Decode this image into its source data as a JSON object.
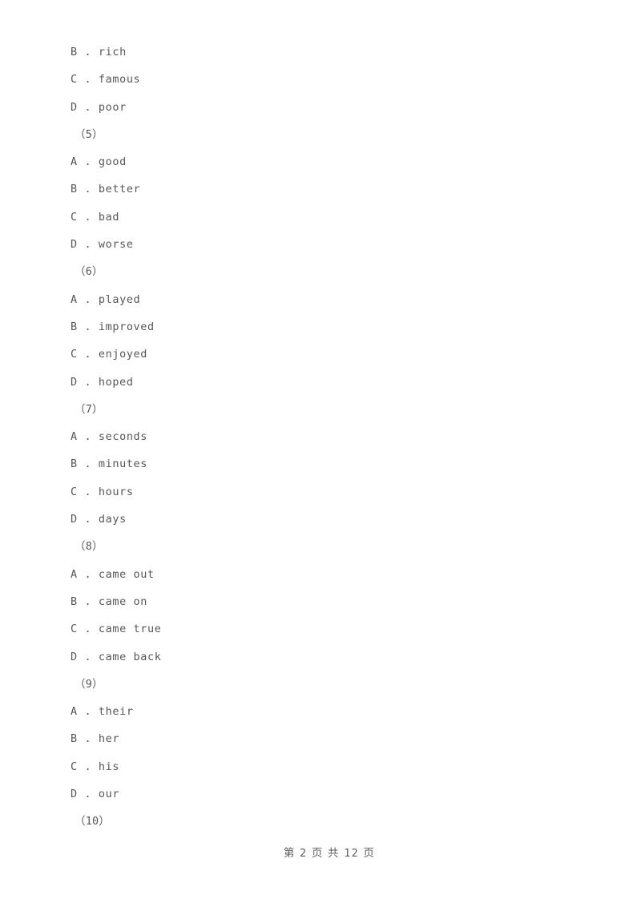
{
  "page": {
    "background_color": "#ffffff",
    "text_color": "#57575a"
  },
  "content": {
    "blocks": [
      {
        "type": "options",
        "items": [
          {
            "letter": "B",
            "sep": " . ",
            "text": "rich"
          },
          {
            "letter": "C",
            "sep": " . ",
            "text": "famous"
          },
          {
            "letter": "D",
            "sep": " . ",
            "text": "poor"
          }
        ]
      },
      {
        "type": "question_number",
        "label": "（5）"
      },
      {
        "type": "options",
        "items": [
          {
            "letter": "A",
            "sep": " . ",
            "text": "good"
          },
          {
            "letter": "B",
            "sep": " . ",
            "text": "better"
          },
          {
            "letter": "C",
            "sep": " . ",
            "text": "bad"
          },
          {
            "letter": "D",
            "sep": " . ",
            "text": "worse"
          }
        ]
      },
      {
        "type": "question_number",
        "label": "（6）"
      },
      {
        "type": "options",
        "items": [
          {
            "letter": "A",
            "sep": " . ",
            "text": "played"
          },
          {
            "letter": "B",
            "sep": " . ",
            "text": "improved"
          },
          {
            "letter": "C",
            "sep": " . ",
            "text": "enjoyed"
          },
          {
            "letter": "D",
            "sep": " . ",
            "text": "hoped"
          }
        ]
      },
      {
        "type": "question_number",
        "label": "（7）"
      },
      {
        "type": "options",
        "items": [
          {
            "letter": "A",
            "sep": " . ",
            "text": "seconds"
          },
          {
            "letter": "B",
            "sep": " . ",
            "text": "minutes"
          },
          {
            "letter": "C",
            "sep": " . ",
            "text": "hours"
          },
          {
            "letter": "D",
            "sep": " . ",
            "text": "days"
          }
        ]
      },
      {
        "type": "question_number",
        "label": "（8）"
      },
      {
        "type": "options",
        "items": [
          {
            "letter": "A",
            "sep": " . ",
            "text": "came out"
          },
          {
            "letter": "B",
            "sep": " . ",
            "text": "came on"
          },
          {
            "letter": "C",
            "sep": " . ",
            "text": "came true"
          },
          {
            "letter": "D",
            "sep": " . ",
            "text": "came back"
          }
        ]
      },
      {
        "type": "question_number",
        "label": "（9）"
      },
      {
        "type": "options",
        "items": [
          {
            "letter": "A",
            "sep": " . ",
            "text": "their"
          },
          {
            "letter": "B",
            "sep": " . ",
            "text": "her"
          },
          {
            "letter": "C",
            "sep": " . ",
            "text": "his"
          },
          {
            "letter": "D",
            "sep": " . ",
            "text": "our"
          }
        ]
      },
      {
        "type": "question_number",
        "label": "（10）"
      }
    ]
  },
  "footer": {
    "prefix": "第",
    "page_number": "2",
    "middle": "页 共",
    "total_pages": "12",
    "suffix": "页",
    "full_text": "第 2 页 共 12 页"
  }
}
